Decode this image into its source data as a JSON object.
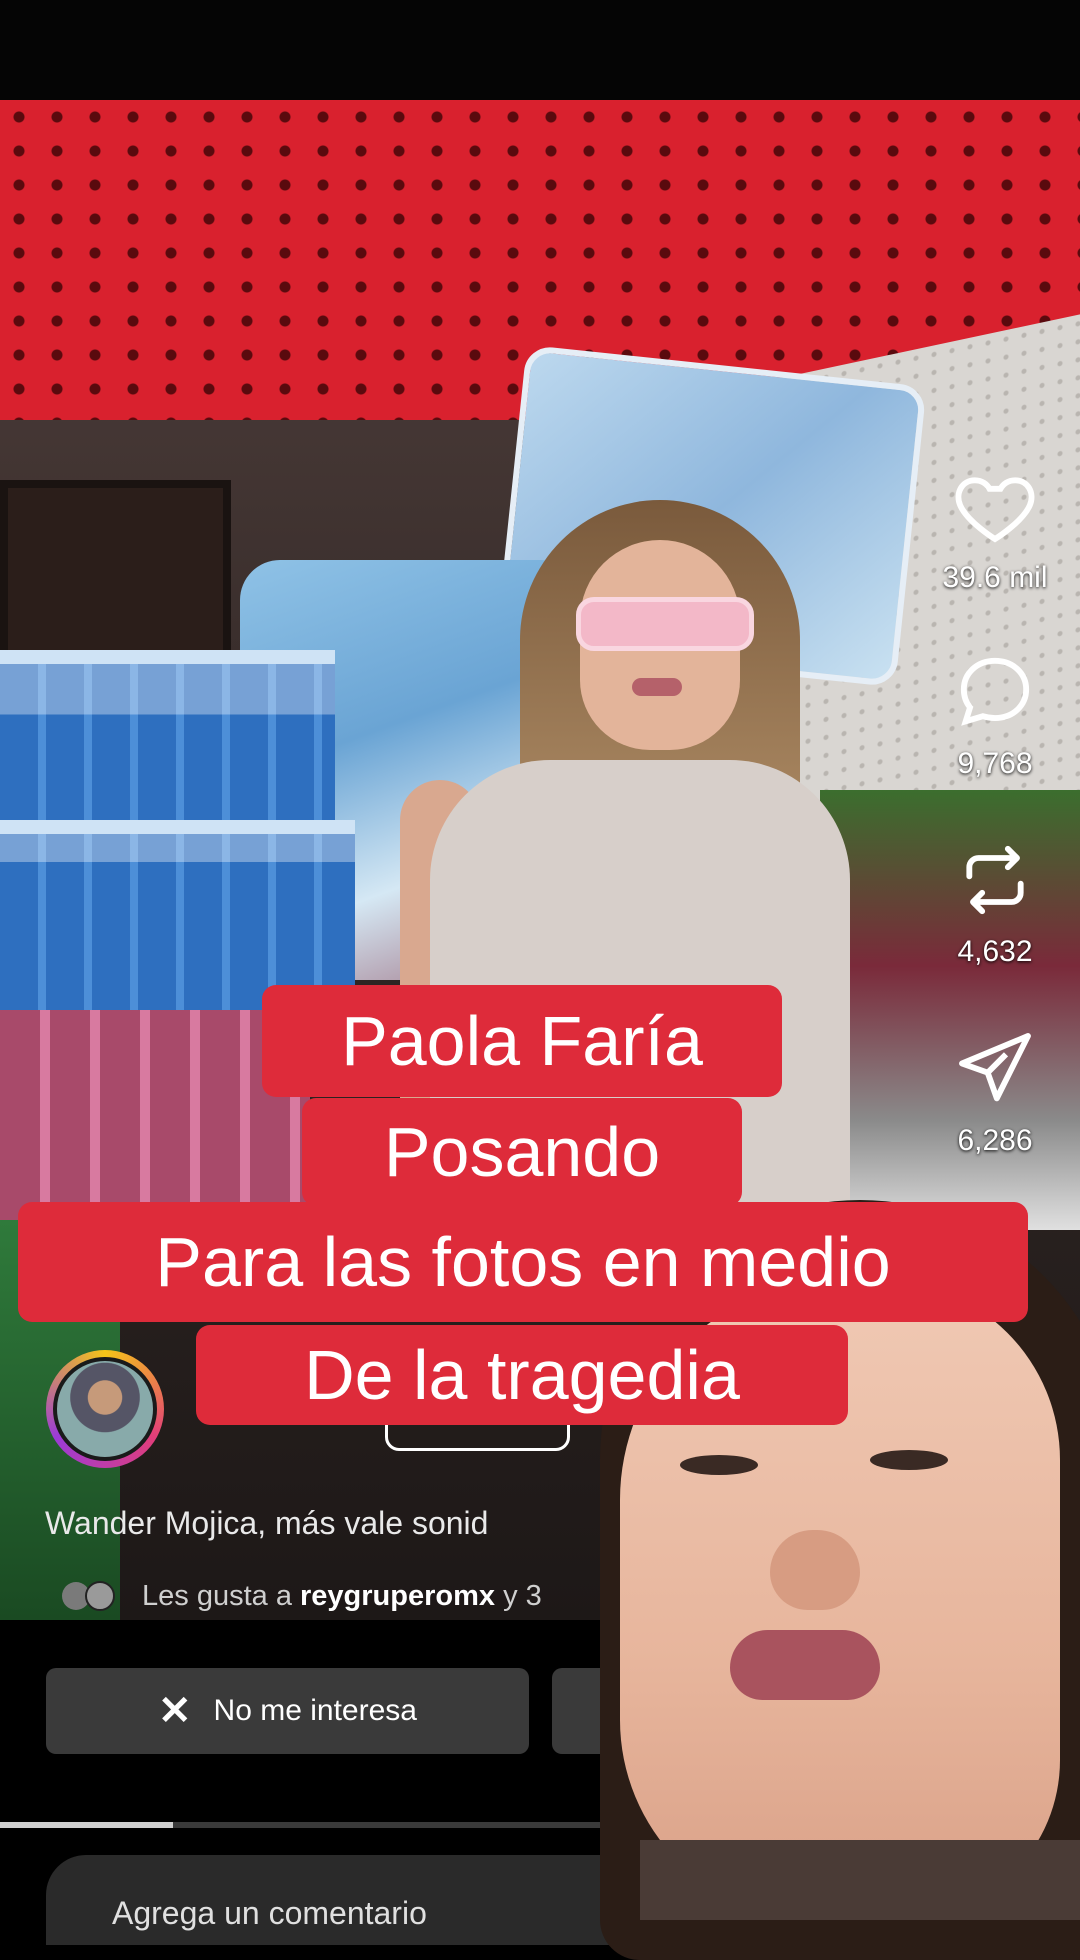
{
  "rail": {
    "likes": "39.6 mil",
    "comments": "9,768",
    "reposts": "4,632",
    "shares": "6,286",
    "like_icon": "heart-icon",
    "comment_icon": "comment-icon",
    "repost_icon": "repost-icon",
    "share_icon": "send-icon"
  },
  "post": {
    "caption": "Wander Mojica, más vale sonid",
    "likers_prefix": "Les gusta a ",
    "likers_name": "reygruperomx",
    "likers_suffix": " y 3"
  },
  "actions": {
    "not_interested": "No me interesa",
    "close_icon": "✕"
  },
  "comment": {
    "placeholder": "Agrega un comentario"
  },
  "overlay_caption": {
    "line1": "Paola Faría",
    "line2": "Posando",
    "line3": "Para las fotos en medio",
    "line4": "De la tragedia"
  },
  "progress": {
    "fraction": 0.16
  },
  "colors": {
    "caption_bg": "#de2b3a",
    "wall_red": "#d9212e"
  }
}
